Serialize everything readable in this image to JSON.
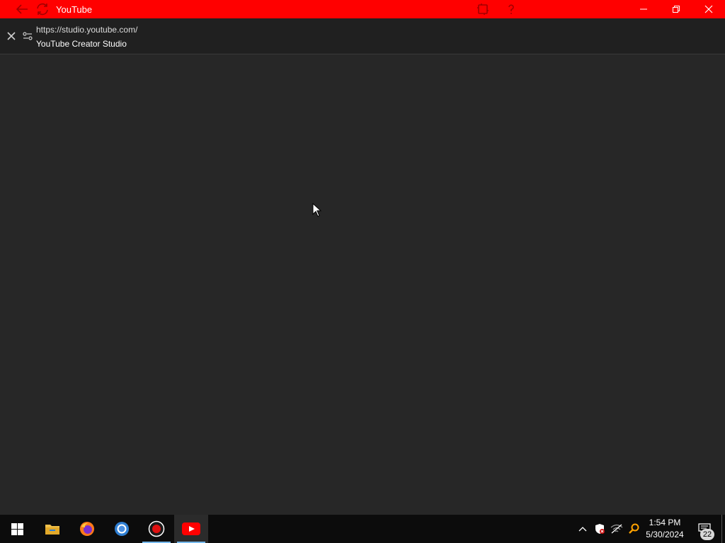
{
  "app": {
    "title": "YouTube",
    "accent_color": "#ff0000"
  },
  "titlebar_icons": {
    "back": "back-arrow-icon",
    "refresh": "refresh-icon",
    "extension": "extension-icon",
    "help": "help-icon",
    "minimize": "minimize-icon",
    "restore": "restore-icon",
    "close": "close-icon"
  },
  "urlbar": {
    "url": "https://studio.youtube.com/",
    "page_title": "YouTube Creator Studio"
  },
  "taskbar": {
    "apps": [
      "start",
      "file-explorer",
      "firefox",
      "chrome",
      "screen-recorder",
      "youtube"
    ],
    "active_app": "youtube"
  },
  "tray": {
    "time": "1:54 PM",
    "date": "5/30/2024",
    "notification_count": "22"
  }
}
